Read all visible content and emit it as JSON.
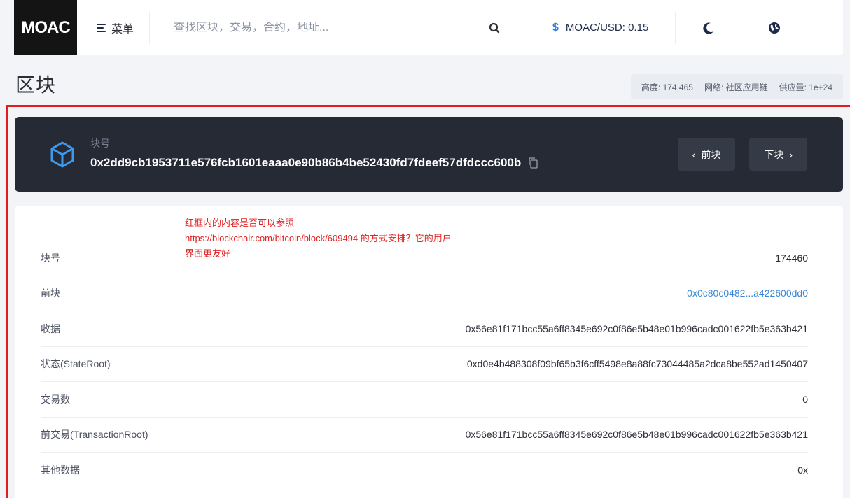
{
  "navbar": {
    "logo": "MOAC",
    "menu_label": "菜单",
    "search_placeholder": "查找区块，交易，合约，地址...",
    "price_symbol": "$",
    "price_label": "MOAC/USD: 0.15",
    "icons": [
      "menu-icon",
      "search-icon",
      "moon-icon",
      "globe-icon"
    ]
  },
  "page": {
    "title": "区块",
    "stats": {
      "height": "高度: 174,465",
      "network": "网络: 社区应用链",
      "supply": "供应量: 1e+24"
    }
  },
  "block": {
    "label": "块号",
    "hash": "0x2dd9cb1953711e576fcb1601eaaa0e90b86b4be52430fd7fdeef57dfdccc600b",
    "prev_button": "前块",
    "next_button": "下块"
  },
  "annotation": {
    "text_line1": "红框内的内容是否可以参照",
    "text_line2": "https://blockchair.com/bitcoin/block/609494 的方式安排？它的用户",
    "text_line3": "界面更友好"
  },
  "details": [
    {
      "label": "块号",
      "value": "174460"
    },
    {
      "label": "前块",
      "value": "0x0c80c0482...a422600dd0"
    },
    {
      "label": "收据",
      "value": "0x56e81f171bcc55a6ff8345e692c0f86e5b48e01b996cadc001622fb5e363b421"
    },
    {
      "label": "状态(StateRoot)",
      "value": "0xd0e4b488308f09bf65b3f6cff5498e8a88fc73044485a2dca8be552ad1450407"
    },
    {
      "label": "交易数",
      "value": "0"
    },
    {
      "label": "前交易(TransactionRoot)",
      "value": "0x56e81f171bcc55a6ff8345e692c0f86e5b48e01b996cadc001622fb5e363b421"
    },
    {
      "label": "其他数据",
      "value": "0x"
    }
  ],
  "colors": {
    "accent": "#2d7be5",
    "link": "#3a87d6",
    "banner_bg": "#262a35",
    "annotation_red": "#e21d1d"
  }
}
